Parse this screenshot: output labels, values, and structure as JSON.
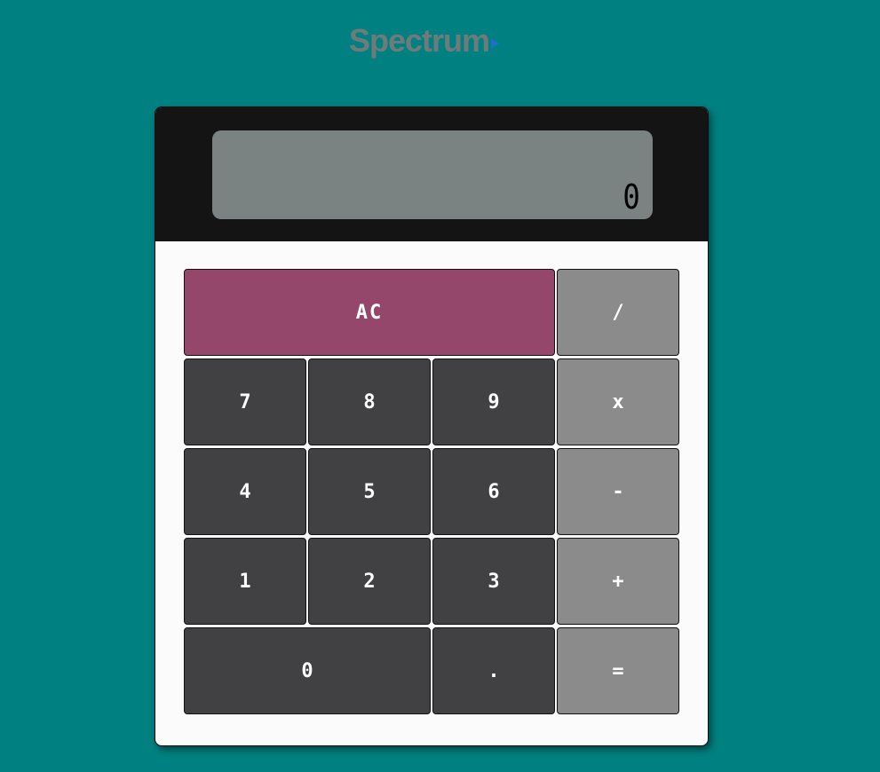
{
  "logo": {
    "text": "Spectrum",
    "arrow_color": "#1f6fc4"
  },
  "display": {
    "value": "0"
  },
  "colors": {
    "background": "#008080",
    "number_key": "#414143",
    "operator_key": "#8b8b8b",
    "clear_key": "#95476b",
    "display_screen": "#7a8381",
    "display_panel": "#141414"
  },
  "keys": {
    "clear": "AC",
    "divide": "/",
    "seven": "7",
    "eight": "8",
    "nine": "9",
    "multiply": "x",
    "four": "4",
    "five": "5",
    "six": "6",
    "subtract": "-",
    "one": "1",
    "two": "2",
    "three": "3",
    "add": "+",
    "zero": "0",
    "decimal": ".",
    "equals": "="
  }
}
